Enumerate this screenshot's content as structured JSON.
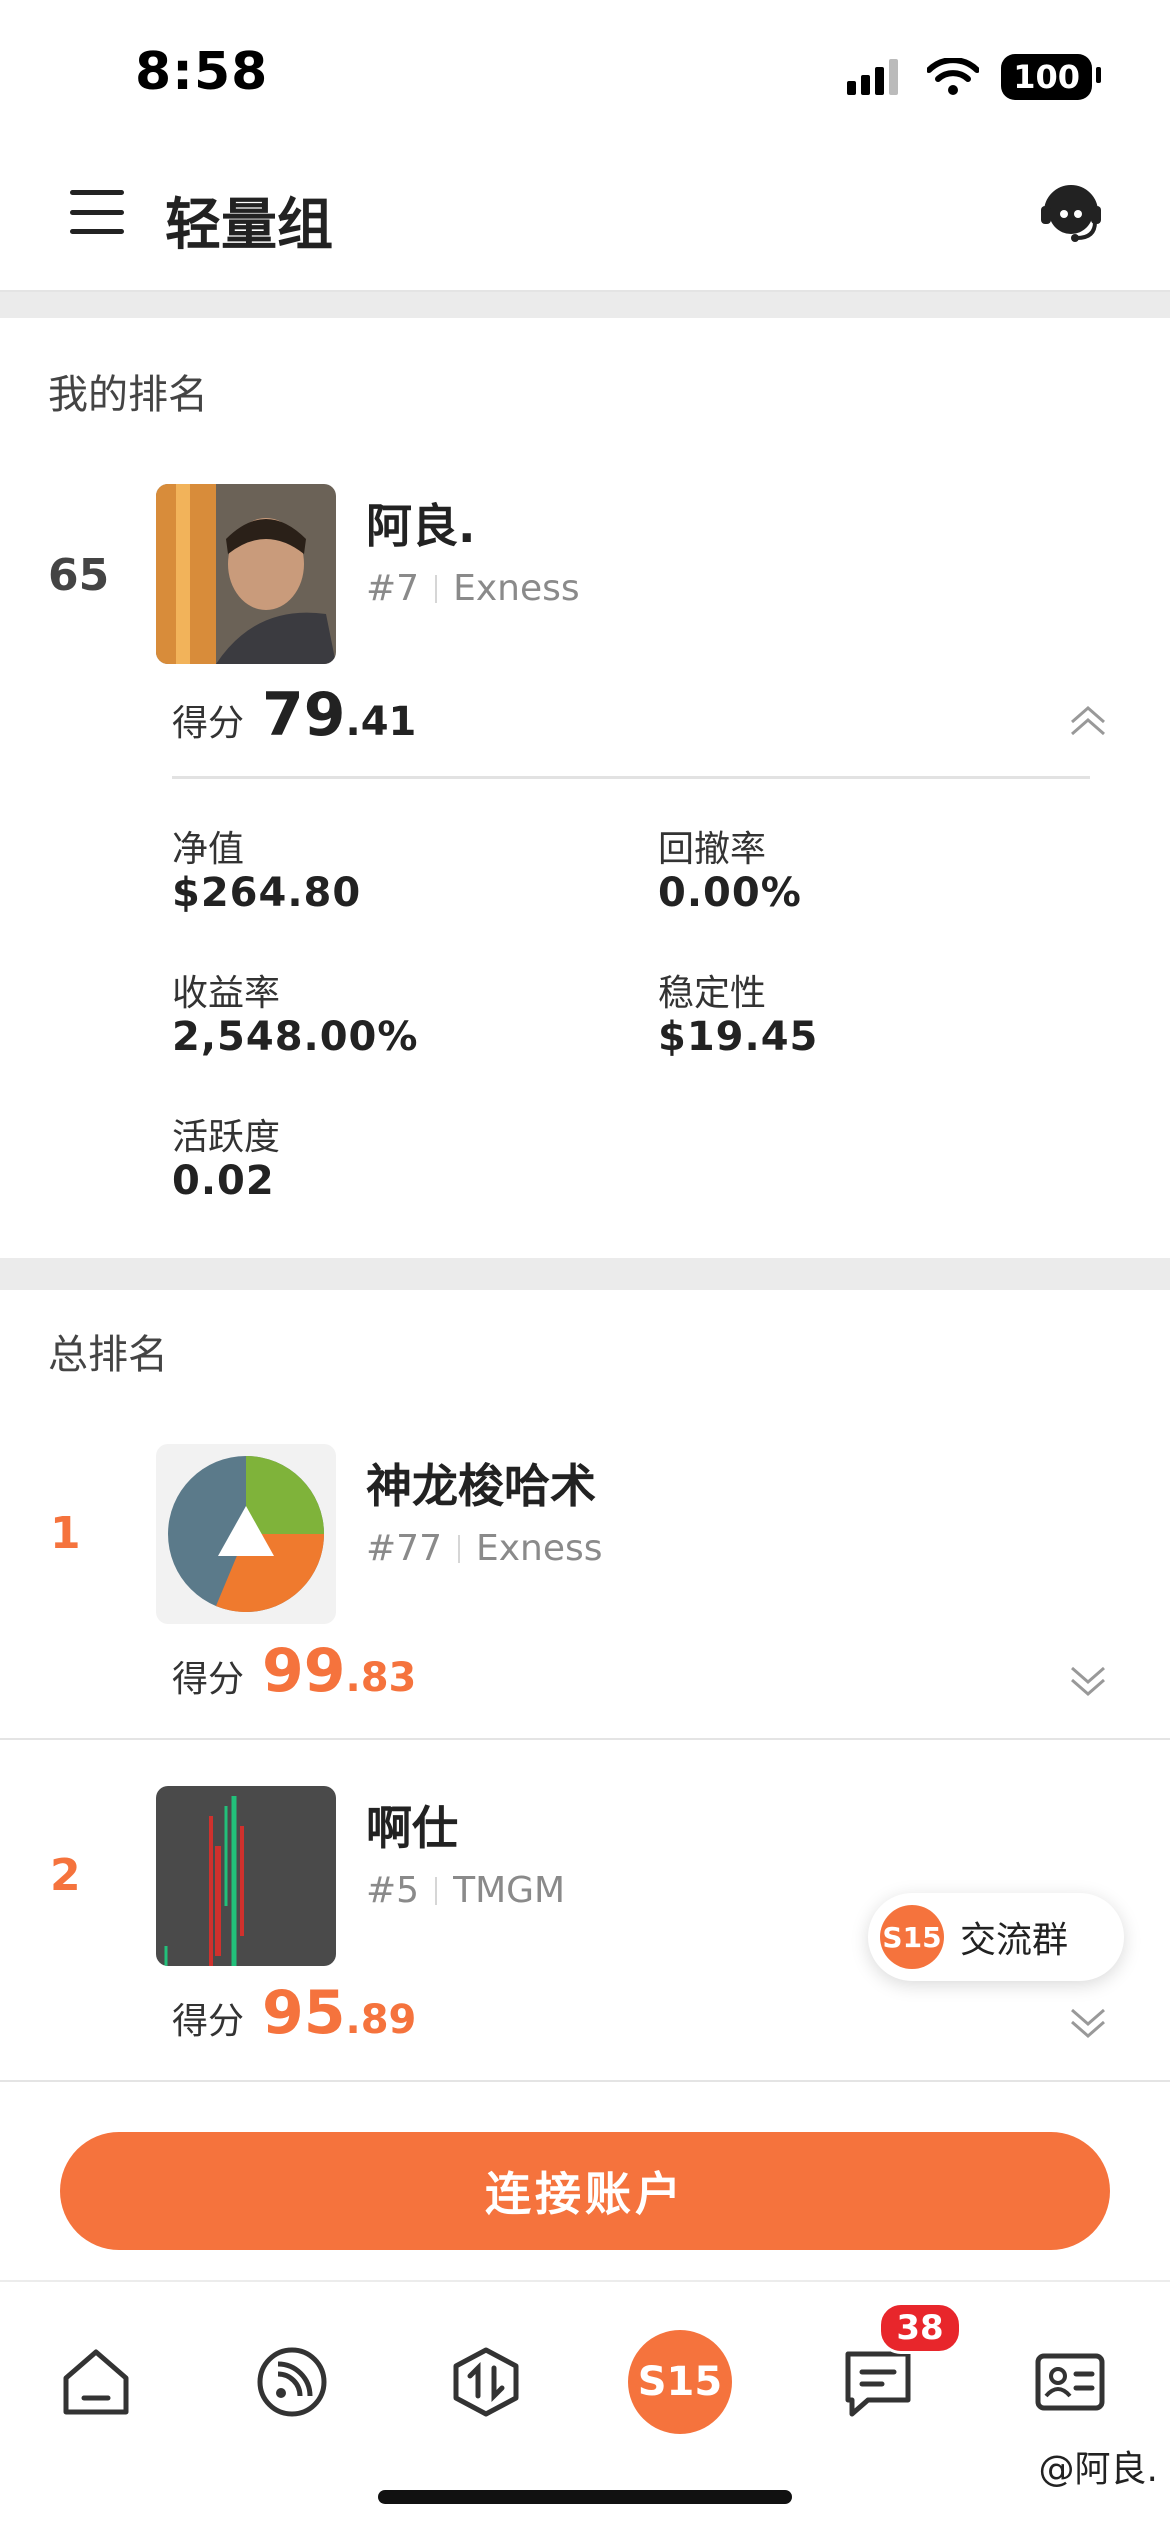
{
  "status_bar": {
    "time": "8:58",
    "battery": "100"
  },
  "header": {
    "title": "轻量组"
  },
  "my_rank": {
    "section_label": "我的排名",
    "rank": "65",
    "name": "阿良.",
    "id": "#7",
    "broker": "Exness",
    "score_label": "得分",
    "score_int": "79",
    "score_dec": ".41",
    "stats": {
      "equity_label": "净值",
      "equity": "$264.80",
      "drawdown_label": "回撤率",
      "drawdown": "0.00%",
      "return_label": "收益率",
      "return": "2,548.00%",
      "stability_label": "稳定性",
      "stability": "$19.45",
      "activity_label": "活跃度",
      "activity": "0.02"
    }
  },
  "overall": {
    "section_label": "总排名",
    "entries": [
      {
        "rank": "1",
        "name": "神龙梭哈术",
        "id": "#77",
        "broker": "Exness",
        "score_label": "得分",
        "score_int": "99",
        "score_dec": ".83"
      },
      {
        "rank": "2",
        "name": "啊仕",
        "id": "#5",
        "broker": "TMGM",
        "score_label": "得分",
        "score_int": "95",
        "score_dec": ".89"
      }
    ]
  },
  "group_chip": {
    "logo": "S15",
    "label": "交流群"
  },
  "connect_button": {
    "label": "连接账户"
  },
  "tabbar": {
    "center_logo": "S15",
    "message_badge": "38"
  },
  "watermark": "@阿良.",
  "colors": {
    "accent": "#f5733d",
    "badge": "#e8262b",
    "text": "#222222",
    "muted": "#8a8a8a"
  }
}
